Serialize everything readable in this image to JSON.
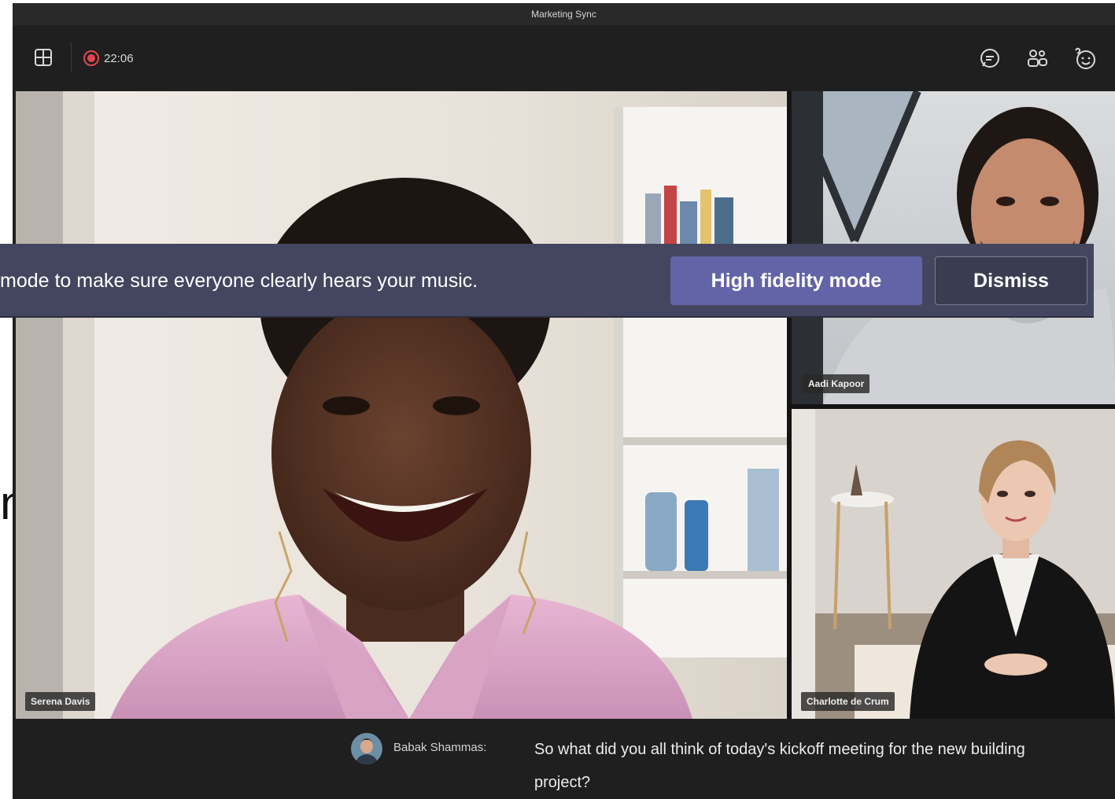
{
  "window": {
    "title": "Marketing Sync"
  },
  "toolbar": {
    "layout_icon": "grid-layout-icon",
    "recording_time": "22:06",
    "right_icons": [
      "chat-icon",
      "participants-icon",
      "reactions-icon"
    ]
  },
  "participants": {
    "main": "Serena Davis",
    "top_right": "Aadi Kapoor",
    "bottom_right": "Charlotte de Crum"
  },
  "banner": {
    "message": "mode to make sure everyone clearly hears your music.",
    "primary_button": "High fidelity mode",
    "dismiss_button": "Dismiss"
  },
  "caption": {
    "speaker": "Babak Shammas:",
    "text": "So what did you all think of today's kickoff meeting for the new building project?"
  },
  "background": {
    "partial_text": "nl"
  },
  "colors": {
    "accent": "#6264a7",
    "banner_bg": "#44465f",
    "window_bg": "#1f1f1f",
    "recording": "#e0474f"
  }
}
